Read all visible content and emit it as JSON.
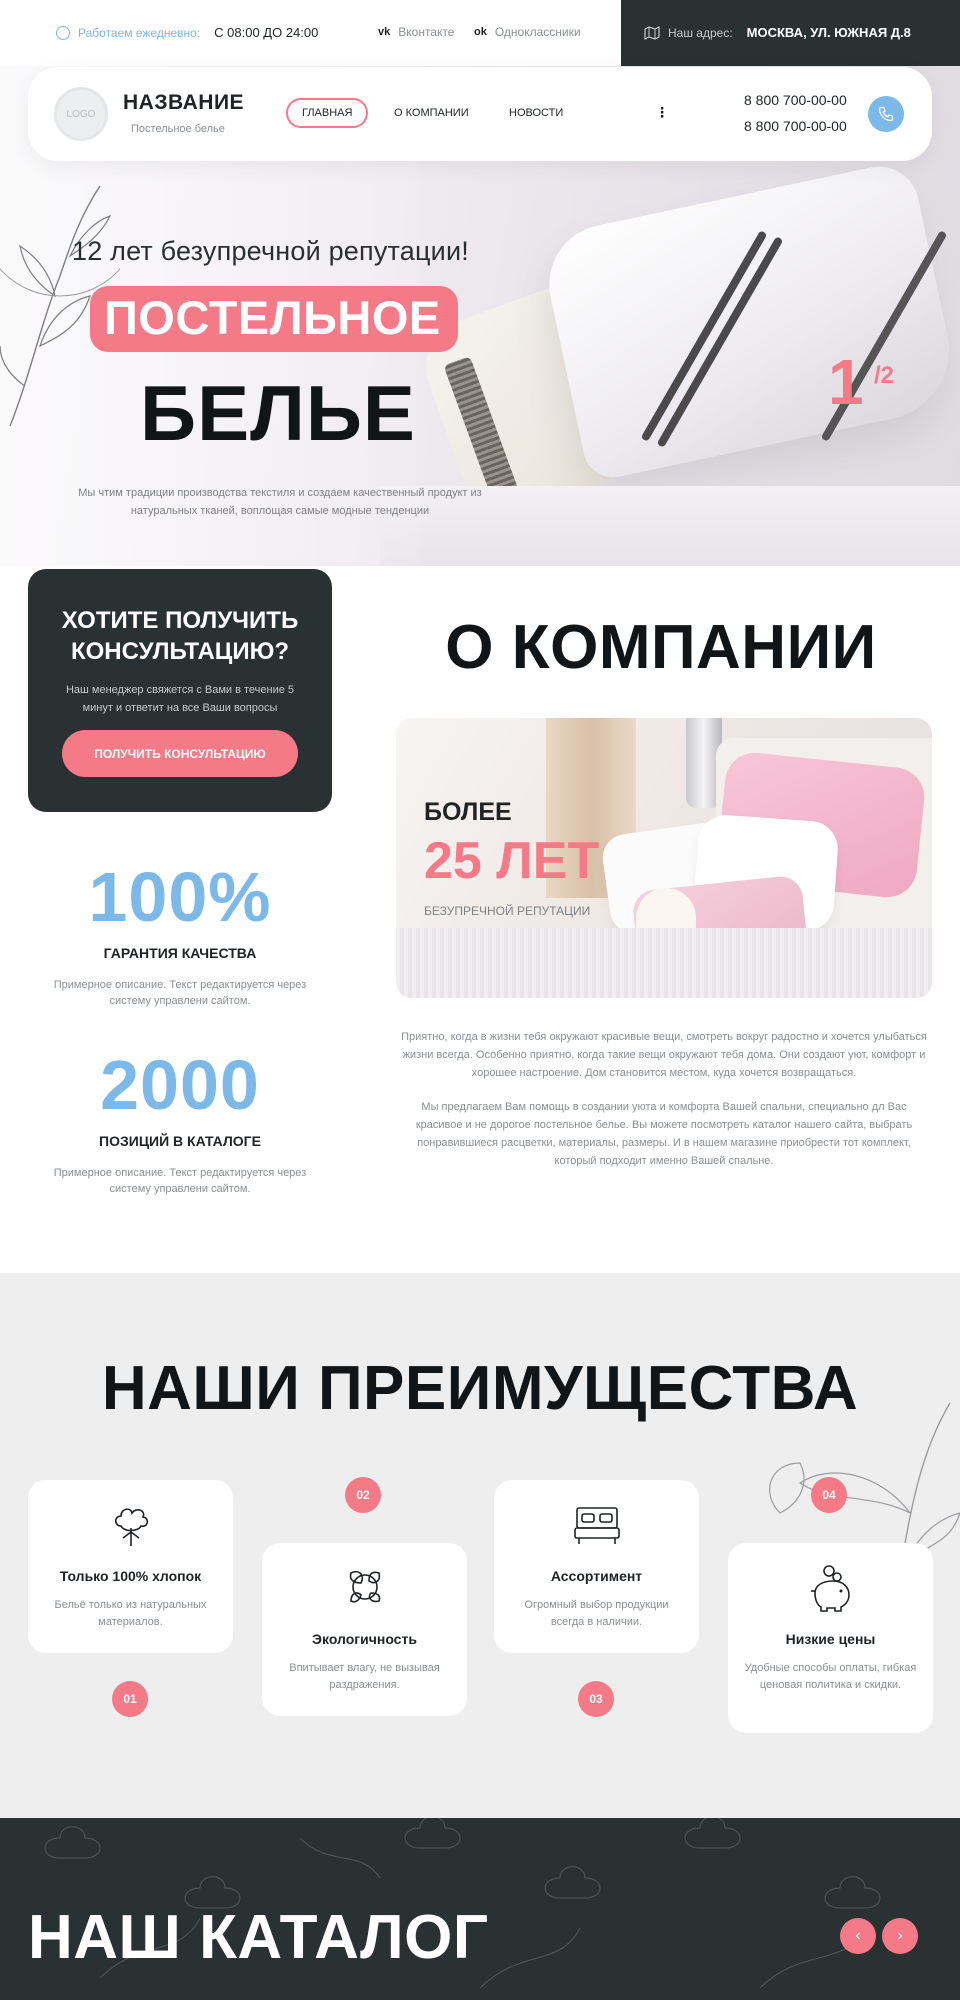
{
  "topbar": {
    "hours_label": "Работаем ежедневно:",
    "hours_value": "С 08:00 ДО 24:00",
    "social": [
      {
        "icon": "vk-icon",
        "glyph": "vk",
        "label": "Вконтакте"
      },
      {
        "icon": "odnoklassniki-icon",
        "glyph": "ok",
        "label": "Одноклассники"
      }
    ],
    "address_label": "Наш адрес:",
    "address_value": "МОСКВА, УЛ. ЮЖНАЯ Д.8"
  },
  "header": {
    "logo_text": "LOGO",
    "brand_title": "НАЗВАНИЕ",
    "brand_subtitle": "Постельное белье",
    "nav": {
      "home": "ГЛАВНАЯ",
      "about": "О КОМПАНИИ",
      "news": "НОВОСТИ",
      "more": "⋮"
    },
    "phones": [
      "8 800 700-00-00",
      "8 800 700-00-00"
    ]
  },
  "hero": {
    "subtitle": "12 лет безупречной репутации!",
    "title_highlight": "ПОСТЕЛЬНОЕ",
    "title_main": "БЕЛЬЕ",
    "description": "Мы чтим традиции производства текстиля и создаем качественный продукт из натуральных тканей, воплощая самые модные тенденции",
    "slide_current": "1",
    "slide_total": "/2"
  },
  "consult": {
    "title": "ХОТИТЕ ПОЛУЧИТЬ КОНСУЛЬТАЦИЮ?",
    "text": "Наш менеджер свяжется с Вами в течение 5 минут и ответит на все Ваши вопросы",
    "button": "ПОЛУЧИТЬ КОНСУЛЬТАЦИЮ"
  },
  "stats": [
    {
      "value": "100%",
      "label": "ГАРАНТИЯ КАЧЕСТВА",
      "desc": "Примерное описание. Текст редактируется через систему управлени сайтом."
    },
    {
      "value": "2000",
      "label": "ПОЗИЦИЙ В КАТАЛОГЕ",
      "desc": "Примерное описание. Текст редактируется через систему управлени сайтом."
    }
  ],
  "about": {
    "title": "О КОМПАНИИ",
    "photo_pre": "БОЛЕЕ",
    "photo_big": "25 ЛЕТ",
    "photo_small": "БЕЗУПРЕЧНОЙ РЕПУТАЦИИ",
    "p1": "Приятно, когда в жизни тебя окружают красивые вещи, смотреть вокруг радостно и хочется улыбаться жизни всегда. Особенно приятно, когда такие вещи окружают тебя дома. Они создают уют, комфорт и хорошее настроение. Дом становится местом, куда хочется возвращаться.",
    "p2": "Мы предлагаем Вам помощь в создании уюта и комфорта Вашей спальни, специально дл Вас красивое и не дорогое постельное белье. Вы можете посмотреть каталог нашего сайта, выбрать понравившиеся расцветки, материалы, размеры. И в нашем магазине приобрести тот комплект, который подходит именно Вашей спальне."
  },
  "advantages": {
    "title": "НАШИ ПРЕИМУЩЕСТВА",
    "items": [
      {
        "num": "01",
        "icon": "cotton-icon",
        "title": "Только 100% хлопок",
        "desc": "Бельё только из натуральных материалов."
      },
      {
        "num": "02",
        "icon": "eco-leaves-icon",
        "title": "Экологичность",
        "desc": "Впитывает влагу, не вызывая раздражения."
      },
      {
        "num": "03",
        "icon": "bed-icon",
        "title": "Ассортимент",
        "desc": "Огромный выбор продукции всегда в наличии."
      },
      {
        "num": "04",
        "icon": "piggy-bank-icon",
        "title": "Низкие цены",
        "desc": "Удобные способы оплаты, гибкая ценовая политика и скидки."
      }
    ]
  },
  "catalog": {
    "title": "НАШ КАТАЛОГ",
    "prev": "‹",
    "next": "›"
  },
  "colors": {
    "accent_pink": "#f47a88",
    "accent_blue": "#7cb8e8",
    "dark": "#2a3133",
    "light_bg": "#eeeeee"
  }
}
